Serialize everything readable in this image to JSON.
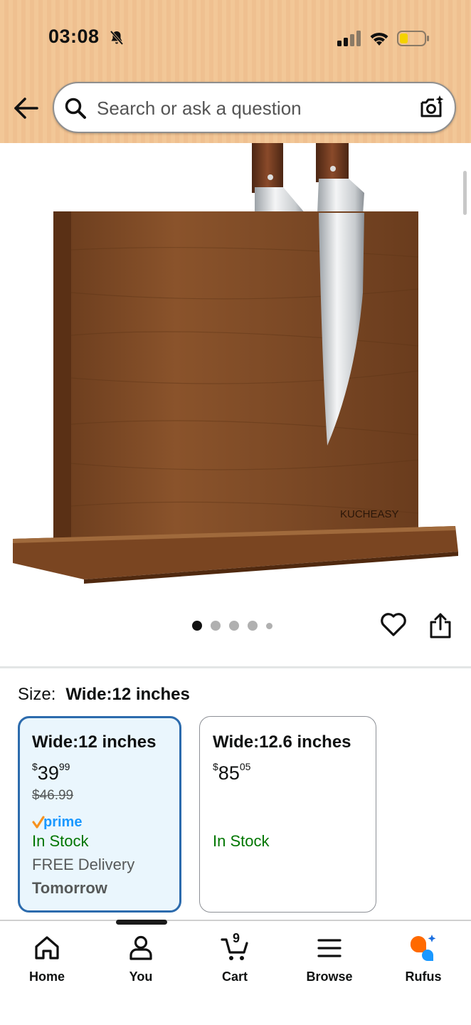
{
  "status_bar": {
    "time": "03:08",
    "icons": [
      "bell-slash-icon",
      "signal-icon",
      "wifi-icon",
      "battery-icon"
    ]
  },
  "header": {
    "back_icon": "arrow-left-icon",
    "search": {
      "placeholder": "Search or ask a question",
      "icon": "search-icon",
      "camera_icon": "camera-sparkle-icon"
    }
  },
  "product_image": {
    "brand_mark": "KUCHEASY",
    "carousel": {
      "count": 5,
      "active_index": 0
    },
    "actions": [
      "heart-icon",
      "share-icon"
    ]
  },
  "size": {
    "label": "Size:",
    "selected": "Wide:12 inches",
    "options": [
      {
        "title": "Wide:12 inches",
        "currency": "$",
        "price_whole": "39",
        "price_fraction": "99",
        "list_price": "$46.99",
        "prime": "prime",
        "stock": "In Stock",
        "delivery": "FREE Delivery",
        "delivery_day": "Tomorrow",
        "selected": true
      },
      {
        "title": "Wide:12.6 inches",
        "currency": "$",
        "price_whole": "85",
        "price_fraction": "05",
        "stock": "In Stock",
        "selected": false
      }
    ]
  },
  "bottom_nav": {
    "items": [
      {
        "label": "Home",
        "icon": "home-icon"
      },
      {
        "label": "You",
        "icon": "user-icon"
      },
      {
        "label": "Cart",
        "icon": "cart-icon",
        "count": "9"
      },
      {
        "label": "Browse",
        "icon": "menu-icon"
      },
      {
        "label": "Rufus",
        "icon": "rufus-icon"
      }
    ]
  },
  "colors": {
    "header_bg": "#f2c797",
    "selected_border": "#2c6bad",
    "selected_bg": "#eaf6fd",
    "in_stock": "#007600",
    "prime_blue": "#1a98ff",
    "prime_check": "#f7921e"
  }
}
